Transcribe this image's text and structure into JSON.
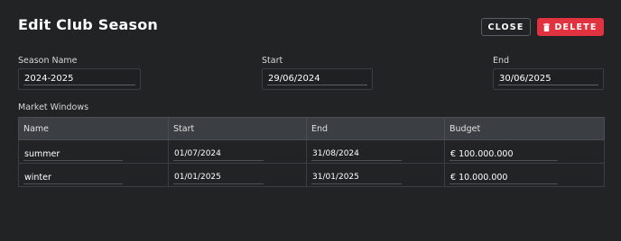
{
  "header": {
    "title": "Edit Club Season",
    "close_label": "CLOSE",
    "delete_label": "DELETE"
  },
  "form": {
    "season_name_label": "Season Name",
    "season_name_value": "2024-2025",
    "start_label": "Start",
    "start_value": "29/06/2024",
    "end_label": "End",
    "end_value": "30/06/2025"
  },
  "market_windows": {
    "section_label": "Market Windows",
    "columns": [
      "Name",
      "Start",
      "End",
      "Budget"
    ],
    "rows": [
      {
        "name": "summer",
        "start": "01/07/2024",
        "end": "31/08/2024",
        "budget": "€ 100.000.000"
      },
      {
        "name": "winter",
        "start": "01/01/2025",
        "end": "31/01/2025",
        "budget": "€ 10.000.000"
      }
    ]
  },
  "colors": {
    "background": "#212325",
    "delete_button": "#e0323f",
    "table_header": "#3b3e42"
  }
}
